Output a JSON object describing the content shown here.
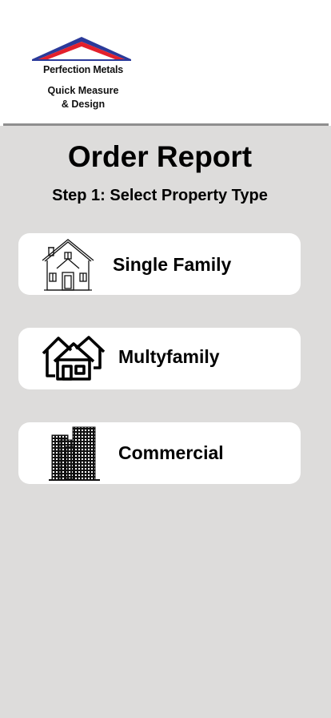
{
  "brand": {
    "name": "Perfection Metals",
    "tagline_line1": "Quick Measure",
    "tagline_line2": "& Design",
    "roof_blue": "#2b3a9a",
    "roof_red": "#e3202c"
  },
  "page": {
    "title": "Order Report",
    "subtitle": "Step 1: Select Property Type"
  },
  "options": [
    {
      "label": "Single Family",
      "icon": "house-icon"
    },
    {
      "label": "Multyfamily",
      "icon": "houses-icon"
    },
    {
      "label": "Commercial",
      "icon": "buildings-icon"
    }
  ],
  "colors": {
    "background": "#dddcdb",
    "card": "#ffffff",
    "divider": "#8f8f8f"
  }
}
